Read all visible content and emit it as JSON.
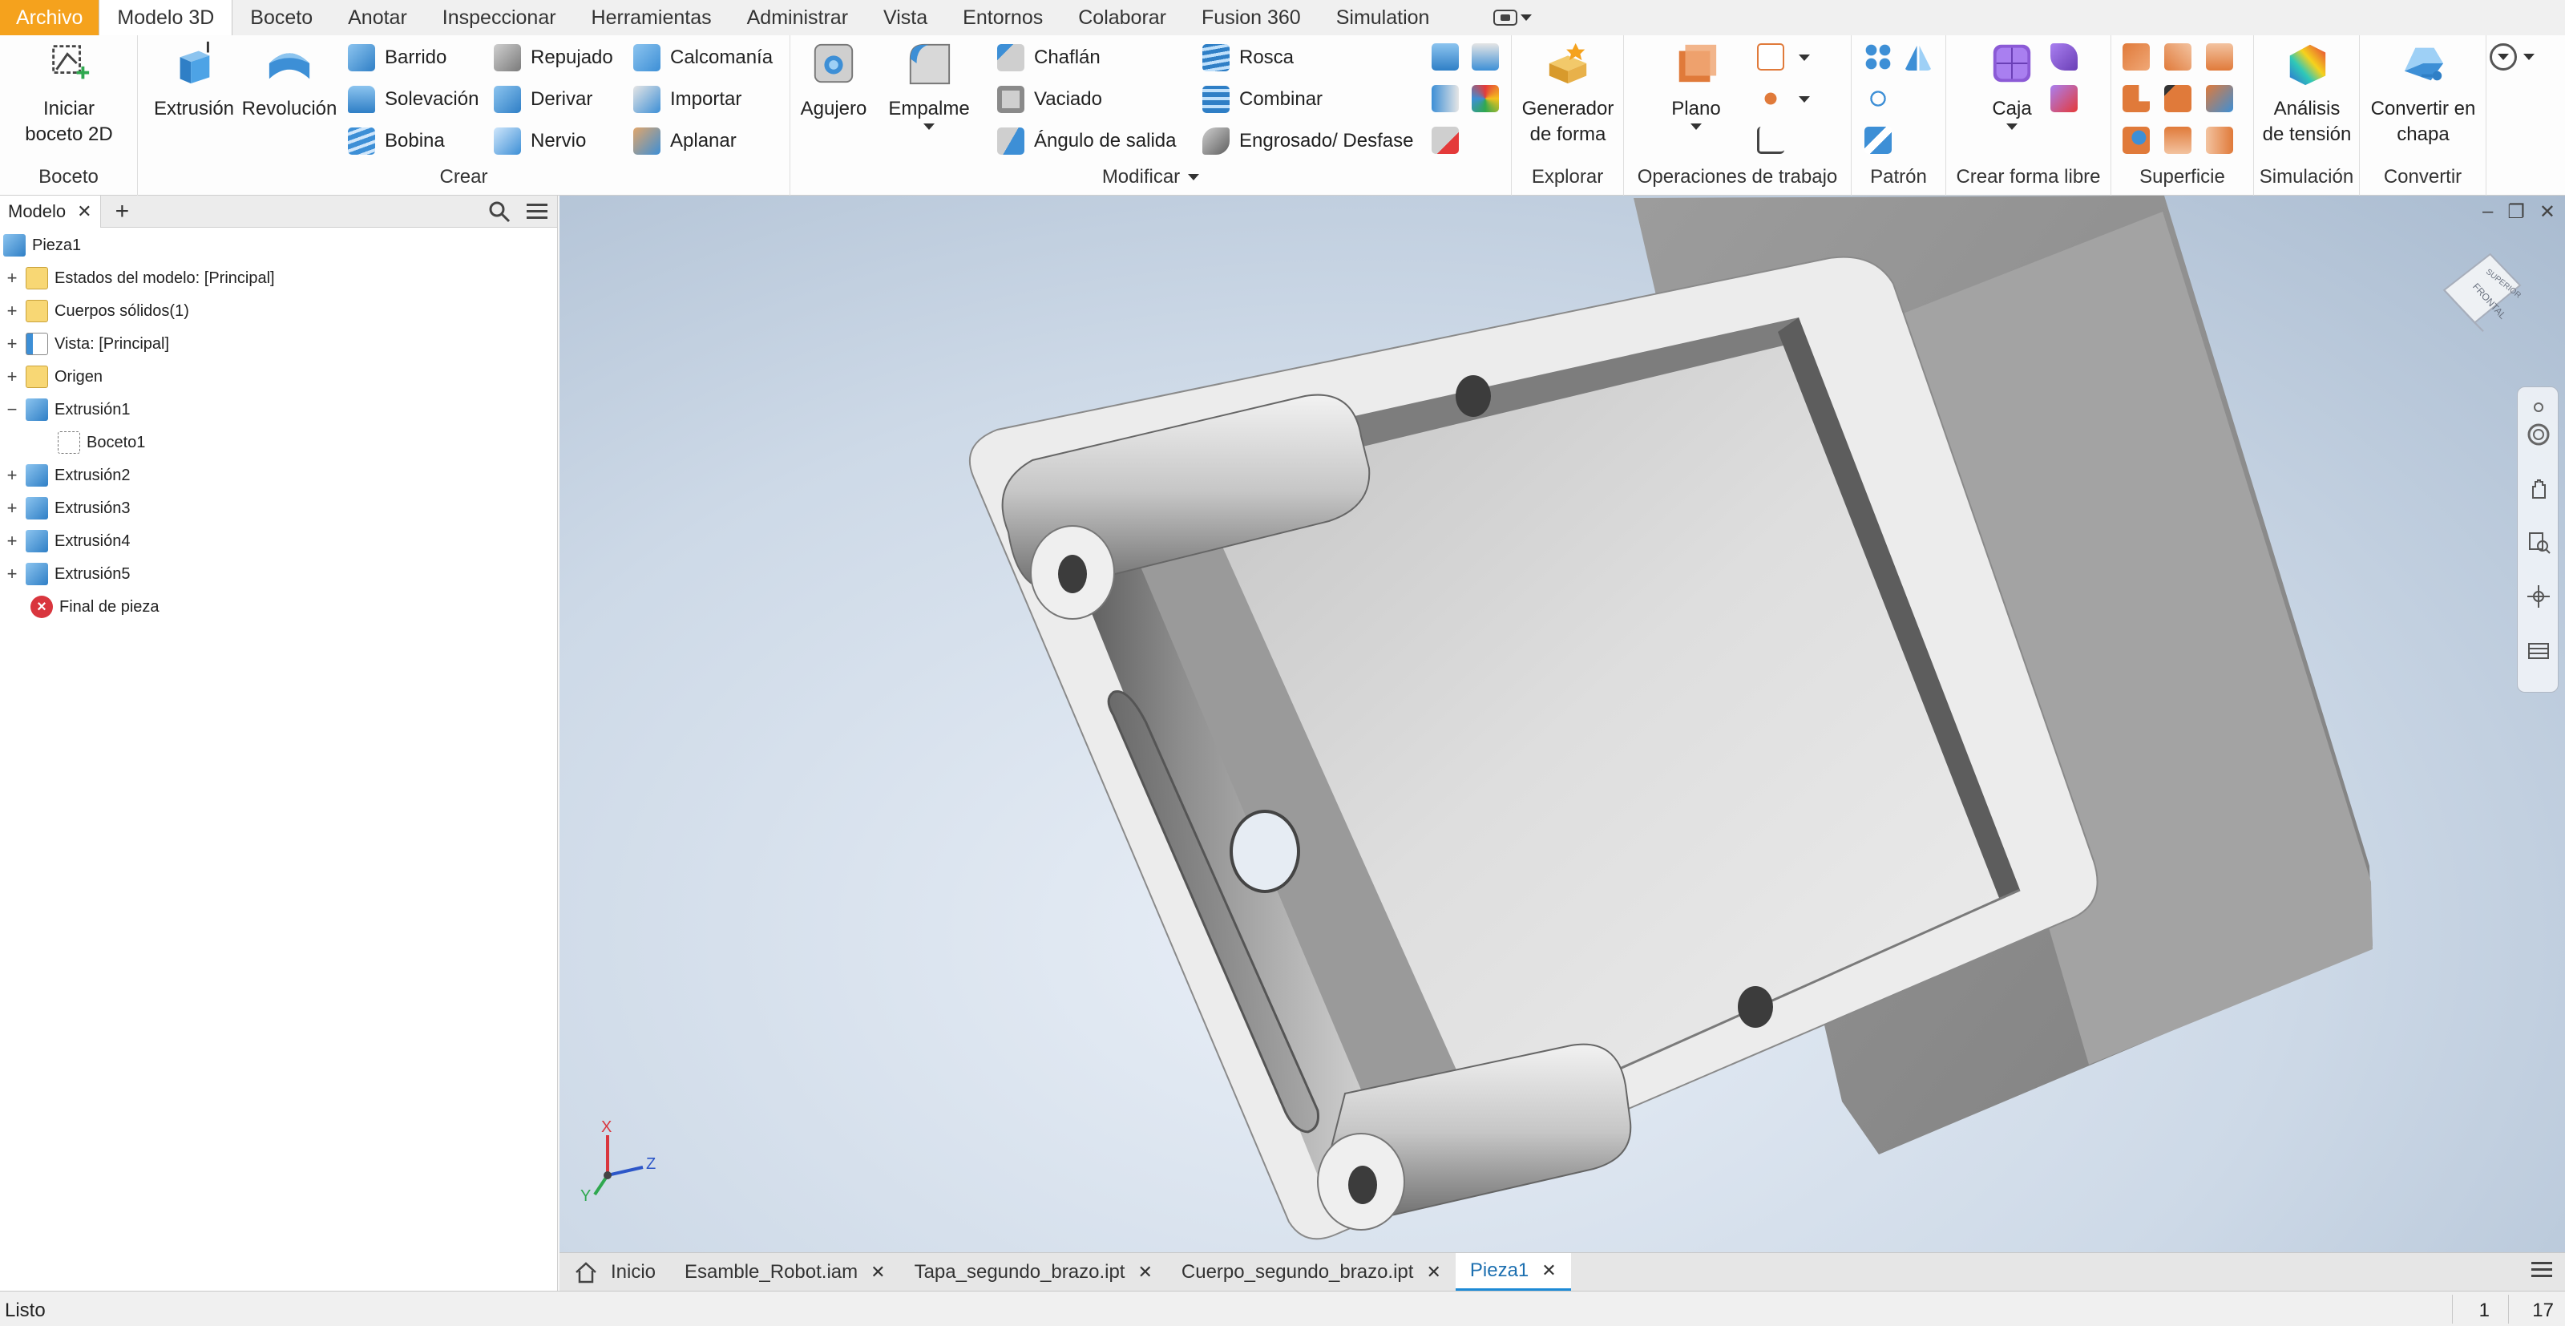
{
  "menu_tabs": [
    "Archivo",
    "Modelo 3D",
    "Boceto",
    "Anotar",
    "Inspeccionar",
    "Herramientas",
    "Administrar",
    "Vista",
    "Entornos",
    "Colaborar",
    "Fusion 360",
    "Simulation"
  ],
  "ribbon": {
    "boceto": {
      "title": "Boceto",
      "start_sketch_line1": "Iniciar",
      "start_sketch_line2": "boceto 2D"
    },
    "crear": {
      "title": "Crear",
      "extrusion": "Extrusión",
      "revolucion": "Revolución",
      "barrido": "Barrido",
      "solevacion": "Solevación",
      "bobina": "Bobina",
      "repujado": "Repujado",
      "derivar": "Derivar",
      "nervio": "Nervio",
      "calcomania": "Calcomanía",
      "importar": "Importar",
      "aplanar": "Aplanar"
    },
    "modificar": {
      "title": "Modificar",
      "agujero": "Agujero",
      "empalme": "Empalme",
      "chaflan": "Chaflán",
      "vaciado": "Vaciado",
      "angulo": "Ángulo de salida",
      "rosca": "Rosca",
      "combinar": "Combinar",
      "engrosado": "Engrosado/ Desfase"
    },
    "explorar": {
      "title": "Explorar",
      "generador_line1": "Generador",
      "generador_line2": "de forma"
    },
    "operaciones": {
      "title": "Operaciones de trabajo",
      "plano": "Plano"
    },
    "patron": {
      "title": "Patrón"
    },
    "forma_libre": {
      "title": "Crear forma libre",
      "caja": "Caja"
    },
    "superficie": {
      "title": "Superficie"
    },
    "simulacion": {
      "title": "Simulación",
      "analisis_line1": "Análisis",
      "analisis_line2": "de tensión"
    },
    "convertir": {
      "title": "Convertir",
      "chapa_line1": "Convertir en",
      "chapa_line2": "chapa"
    }
  },
  "sidebar": {
    "tab_label": "Modelo",
    "tree": [
      {
        "label": "Pieza1",
        "icon": "part-icon"
      },
      {
        "label": "Estados del modelo: [Principal]",
        "icon": "folder-icon"
      },
      {
        "label": "Cuerpos sólidos(1)",
        "icon": "folder-icon"
      },
      {
        "label": "Vista: [Principal]",
        "icon": "view-icon"
      },
      {
        "label": "Origen",
        "icon": "folder-icon"
      },
      {
        "label": "Extrusión1",
        "icon": "extrude-icon"
      },
      {
        "label": "Boceto1",
        "icon": "sketch-icon"
      },
      {
        "label": "Extrusión2",
        "icon": "extrude-icon"
      },
      {
        "label": "Extrusión3",
        "icon": "extrude-icon"
      },
      {
        "label": "Extrusión4",
        "icon": "extrude-icon"
      },
      {
        "label": "Extrusión5",
        "icon": "extrude-icon"
      },
      {
        "label": "Final de pieza",
        "icon": "end-of-part-icon"
      }
    ]
  },
  "viewcube": {
    "face_front": "FRONTAL",
    "face_top": "SUPERIOR"
  },
  "triad": {
    "x": "X",
    "y": "Y",
    "z": "Z"
  },
  "doc_tabs": {
    "home": "Inicio",
    "t1": "Esamble_Robot.iam",
    "t2": "Tapa_segundo_brazo.ipt",
    "t3": "Cuerpo_segundo_brazo.ipt",
    "t4": "Pieza1"
  },
  "status": {
    "text": "Listo",
    "num1": "1",
    "num2": "17"
  },
  "colors": {
    "accent": "#f5a21d",
    "active_tab": "#1c8ad6",
    "part_blue": "#3d8fd6"
  }
}
